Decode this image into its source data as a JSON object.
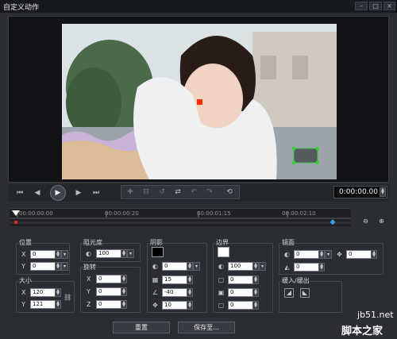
{
  "window": {
    "title": "自定义动作"
  },
  "transport": {
    "icons": [
      "skip-to-start-icon",
      "step-back-icon",
      "play-icon",
      "step-forward-icon",
      "skip-to-end-icon"
    ],
    "edit_tools": [
      "add-keyframe-icon",
      "remove-keyframe-icon",
      "reverse-icon",
      "swap-icon",
      "previous-keyframe-icon",
      "next-keyframe-icon",
      "reset-icon"
    ],
    "timecode": "0:00:00.00"
  },
  "timeline": {
    "ticks": [
      "00:00:00:00",
      "00:00:00:20",
      "00:00:01:15",
      "00:00:02:10"
    ]
  },
  "panels": {
    "position": {
      "title": "位置",
      "x_label": "X",
      "x": "0",
      "y_label": "Y",
      "y": "0"
    },
    "size": {
      "title": "大小",
      "x_label": "X",
      "x": "120",
      "y_label": "Y",
      "y": "121"
    },
    "opacity": {
      "title": "阻光度",
      "value": "100"
    },
    "rotation": {
      "title": "旋转",
      "x_label": "X",
      "x": "0",
      "y_label": "Y",
      "y": "0",
      "z_label": "Z",
      "z": "0"
    },
    "shadow": {
      "title": "阴影",
      "v1": "0",
      "v2": "15",
      "v3": "-40",
      "v4": "10"
    },
    "border": {
      "title": "边界",
      "v1": "100",
      "v2": "0",
      "v3": "0",
      "v4": "0"
    },
    "mirror": {
      "title": "镜面",
      "v1": "0",
      "v2": "0",
      "v3": "0"
    },
    "fade": {
      "title": "缓入/缓出"
    }
  },
  "buttons": {
    "reset": "重置",
    "save_to": "保存至..."
  },
  "watermark": {
    "line1": "jb51.net",
    "line2": "脚本之家"
  },
  "colors": {
    "shadow_swatch": "#000000",
    "border_swatch": "#ffffff",
    "keyframe_marker": "#d9301e"
  }
}
